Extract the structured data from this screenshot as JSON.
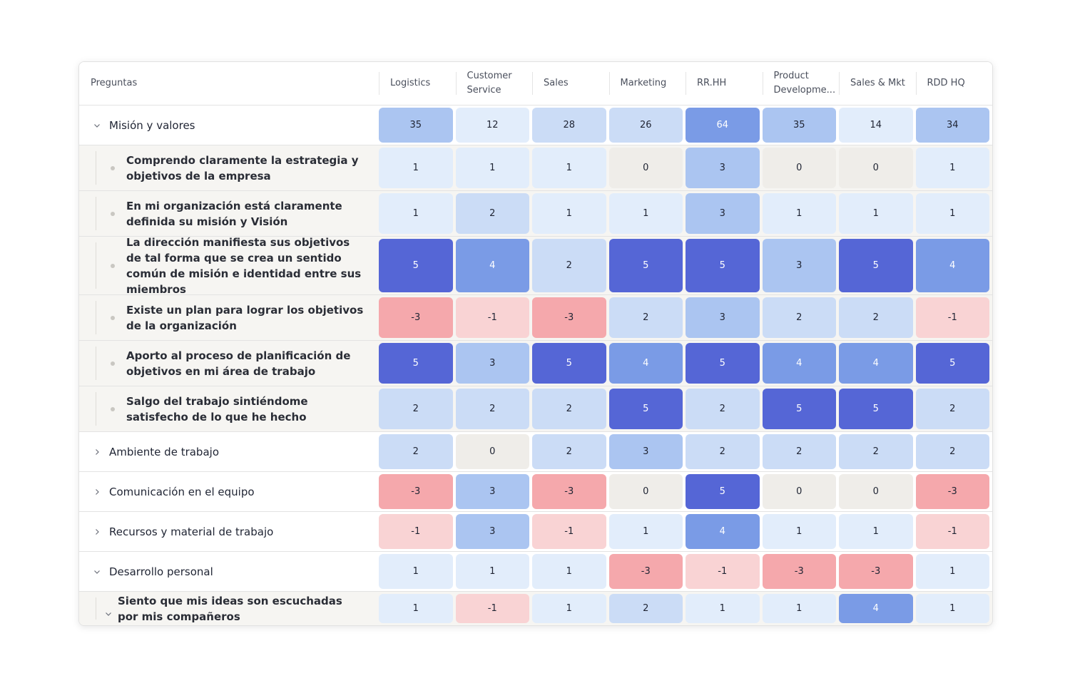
{
  "table": {
    "question_header": "Preguntas",
    "columns": [
      "Logistics",
      "Customer Service",
      "Sales",
      "Marketing",
      "RR.HH",
      "Product Developme...",
      "Sales & Mkt",
      "RDD HQ"
    ],
    "rows": [
      {
        "type": "group",
        "expanded": true,
        "label": "Misión y valores",
        "values": [
          35,
          12,
          28,
          26,
          64,
          35,
          14,
          34
        ]
      },
      {
        "type": "child",
        "label": "Comprendo claramente la estrategia y objetivos de la empresa",
        "values": [
          1,
          1,
          1,
          0,
          3,
          0,
          0,
          1
        ]
      },
      {
        "type": "child",
        "label": "En mi organización está claramente definida su misión y Visión",
        "values": [
          1,
          2,
          1,
          1,
          3,
          1,
          1,
          1
        ]
      },
      {
        "type": "child",
        "label": "La dirección manifiesta sus objetivos de tal forma que se crea un sentido común de misión e identidad entre sus miembros",
        "values": [
          5,
          4,
          2,
          5,
          5,
          3,
          5,
          4
        ]
      },
      {
        "type": "child",
        "label": "Existe un plan para lograr los objetivos de la organización",
        "values": [
          -3,
          -1,
          -3,
          2,
          3,
          2,
          2,
          -1
        ]
      },
      {
        "type": "child",
        "label": "Aporto al proceso de planificación de objetivos en mi área de trabajo",
        "values": [
          5,
          3,
          5,
          4,
          5,
          4,
          4,
          5
        ]
      },
      {
        "type": "child",
        "label": "Salgo del trabajo sintiéndome satisfecho de lo que he hecho",
        "values": [
          2,
          2,
          2,
          5,
          2,
          5,
          5,
          2
        ]
      },
      {
        "type": "group",
        "expanded": false,
        "label": "Ambiente de trabajo",
        "values": [
          2,
          0,
          2,
          3,
          2,
          2,
          2,
          2
        ]
      },
      {
        "type": "group",
        "expanded": false,
        "label": "Comunicación en el equipo",
        "values": [
          -3,
          3,
          -3,
          0,
          5,
          0,
          0,
          -3
        ]
      },
      {
        "type": "group",
        "expanded": false,
        "label": "Recursos y material de trabajo",
        "values": [
          -1,
          3,
          -1,
          1,
          4,
          1,
          1,
          -1
        ]
      },
      {
        "type": "group",
        "expanded": true,
        "label": "Desarrollo personal",
        "values": [
          1,
          1,
          1,
          -3,
          -1,
          -3,
          -3,
          1
        ]
      },
      {
        "type": "child",
        "expandable": true,
        "label": "Siento que mis ideas son escuchadas por mis compañeros",
        "values": [
          1,
          -1,
          1,
          2,
          1,
          1,
          4,
          1
        ]
      }
    ]
  },
  "colors": {
    "neg3": "#f5a8ac",
    "neg1": "#f9d3d4",
    "zero": "#efede9",
    "pos1": "#e2edfb",
    "pos2": "#cbdcf6",
    "pos3": "#abc5f1",
    "pos4": "#7a9be6",
    "pos5": "#5566d6",
    "dark_text": "#1f2433",
    "light_text": "#ffffff"
  }
}
